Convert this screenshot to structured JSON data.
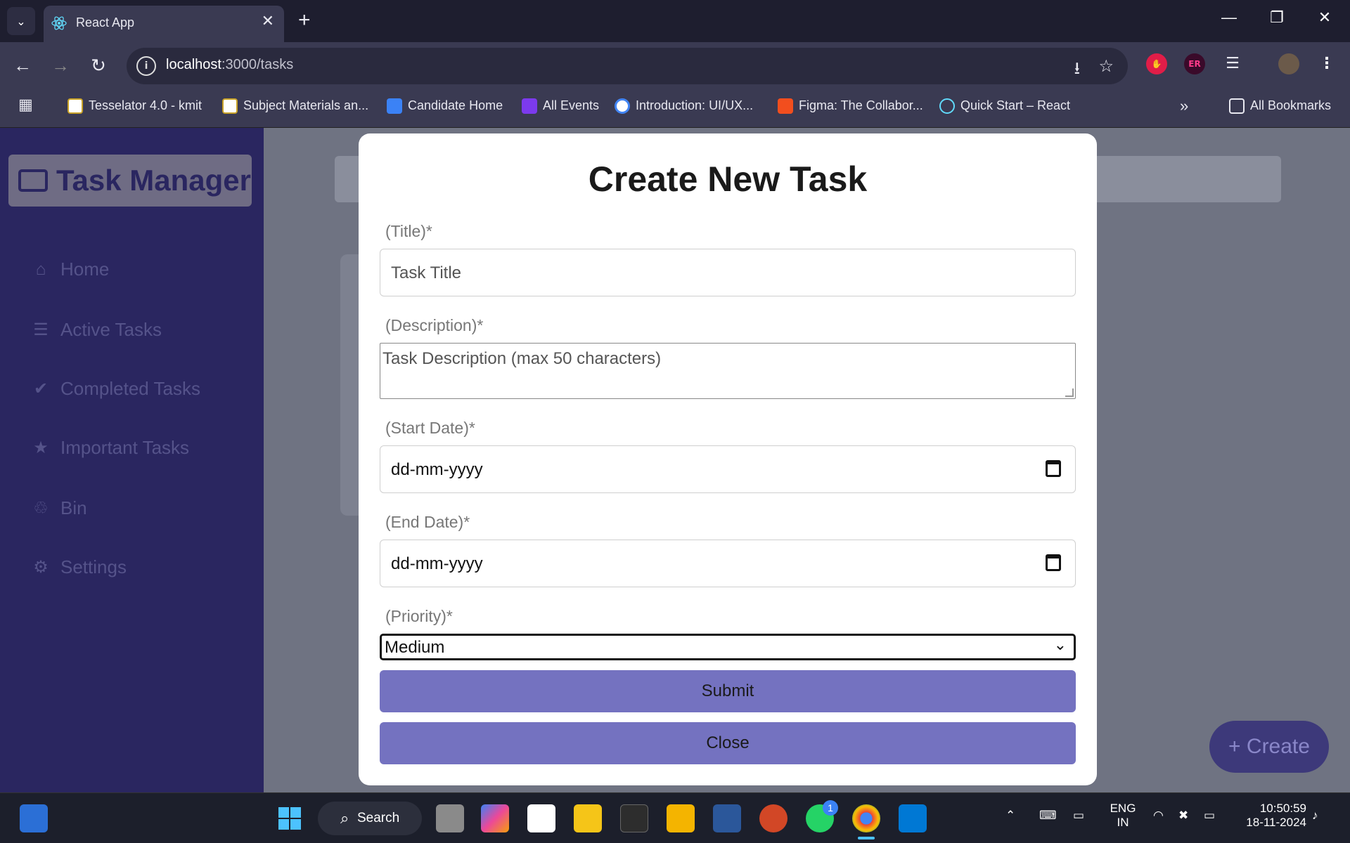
{
  "browser": {
    "tab_title": "React App",
    "url_host": "localhost",
    "url_path": ":3000/tasks",
    "bookmarks": [
      {
        "label": "Tesselator 4.0 - kmit",
        "color": "#c9a227"
      },
      {
        "label": "Subject Materials an...",
        "color": "#c9a227"
      },
      {
        "label": "Candidate Home",
        "color": "#3b82f6"
      },
      {
        "label": "All Events",
        "color": "#7c3aed"
      },
      {
        "label": "Introduction: UI/UX...",
        "color": "#4285f4"
      },
      {
        "label": "Figma: The Collabor...",
        "color": "#f24e1e"
      },
      {
        "label": "Quick Start – React",
        "color": "#61dafb"
      }
    ],
    "all_bookmarks": "All Bookmarks",
    "more_chevron": "»"
  },
  "sidebar": {
    "brand_title": "Task Manager",
    "items": [
      {
        "label": "Home",
        "icon": "⌂"
      },
      {
        "label": "Active Tasks",
        "icon": "☰"
      },
      {
        "label": "Completed Tasks",
        "icon": "✔"
      },
      {
        "label": "Important Tasks",
        "icon": "★"
      },
      {
        "label": "Bin",
        "icon": "♲"
      },
      {
        "label": "Settings",
        "icon": "⚙"
      }
    ]
  },
  "fab": {
    "label": "+ Create"
  },
  "modal": {
    "heading": "Create New Task",
    "title_label": "(Title)*",
    "title_placeholder": "Task Title",
    "description_label": "(Description)*",
    "description_placeholder": "Task Description (max 50 characters)",
    "start_label": "(Start Date)*",
    "start_value": "dd-mm-yyyy",
    "end_label": "(End Date)*",
    "end_value": "dd-mm-yyyy",
    "priority_label": "(Priority)*",
    "priority_value": "Medium",
    "submit_label": "Submit",
    "close_label": "Close"
  },
  "taskbar": {
    "search_label": "Search",
    "lang_top": "ENG",
    "lang_bottom": "IN",
    "time": "10:50:59",
    "date": "18-11-2024",
    "whatsapp_badge": "1"
  },
  "colors": {
    "sidebar_bg": "#2a2660",
    "accent_button": "#7472c0",
    "page_overlay": "#6f7382"
  }
}
